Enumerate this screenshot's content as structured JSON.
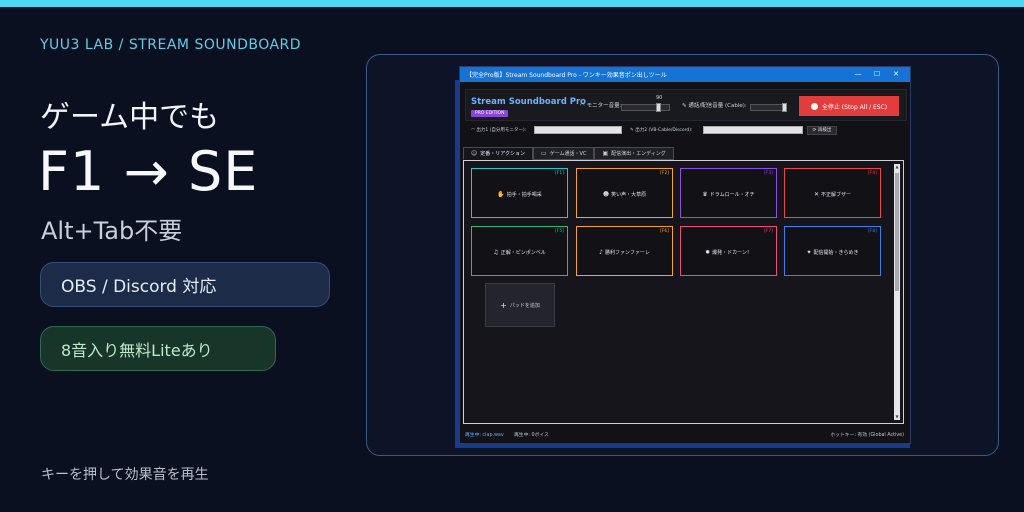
{
  "promo": {
    "brand": "YUU3 LAB  /  STREAM SOUNDBOARD",
    "headline1": "ゲーム中でも",
    "headline2": "F1 → SE",
    "headline3": "Alt+Tab不要",
    "pill_obs": "OBS / Discord 対応",
    "pill_lite": "8音入り無料Liteあり",
    "footer": "キーを押して効果音を再生",
    "accent_color": "#4fd6f2"
  },
  "app": {
    "window_title": "【完全Pro版】Stream Soundboard Pro - ワンキー効果音ポン出しツール",
    "window_controls": {
      "minimize": "—",
      "maximize": "☐",
      "close": "✕"
    },
    "name": "Stream Soundboard Pro",
    "badge": "PRO EDITION",
    "monitor_label": "モニター音量:",
    "monitor_value": "90",
    "monitor_level": 0.9,
    "call_label": "通話/配信音量 (Cable):",
    "call_level": 1.0,
    "stop_button": "全停止 (Stop All / ESC)",
    "output1_label": "出力1 (自分用モニター):",
    "output2_label": "出力2 (VB-Cable/Discord):",
    "redetect_button": "再検出",
    "tabs": [
      {
        "label": "定番・リアクション",
        "icon": "☺"
      },
      {
        "label": "ゲーム通話・VC",
        "icon": "▭"
      },
      {
        "label": "配信演出・エンディング",
        "icon": "▣"
      }
    ],
    "pads": [
      {
        "key": "[F1]",
        "label": "拍手・拍手喝采",
        "icon": "✋",
        "color": "#25c7c9"
      },
      {
        "key": "[F2]",
        "label": "笑い声・大草原",
        "icon": "☻",
        "color": "#f0a428"
      },
      {
        "key": "[F3]",
        "label": "ドラムロール・オチ",
        "icon": "♛",
        "color": "#8c4fe0"
      },
      {
        "key": "[F4]",
        "label": "不正解ブザー",
        "icon": "✕",
        "color": "#e84a4a"
      },
      {
        "key": "[F5]",
        "label": "正解・ピンポンベル",
        "icon": "♫",
        "color": "#2fb87a"
      },
      {
        "key": "[F6]",
        "label": "勝利ファンファーレ",
        "icon": "♪",
        "color": "#f0a428"
      },
      {
        "key": "[F7]",
        "label": "爆発・ドカーン！",
        "icon": "✹",
        "color": "#e8507a"
      },
      {
        "key": "[F8]",
        "label": "配信開始・きらめき",
        "icon": "✦",
        "color": "#3f7fe8"
      }
    ],
    "add_pad": "パッドを追加",
    "status_playing": "再生中: clap.wav",
    "status_voices": "再生中: 0ボイス",
    "status_hotkey": "ホットキー: 有効 (Global Active)"
  }
}
